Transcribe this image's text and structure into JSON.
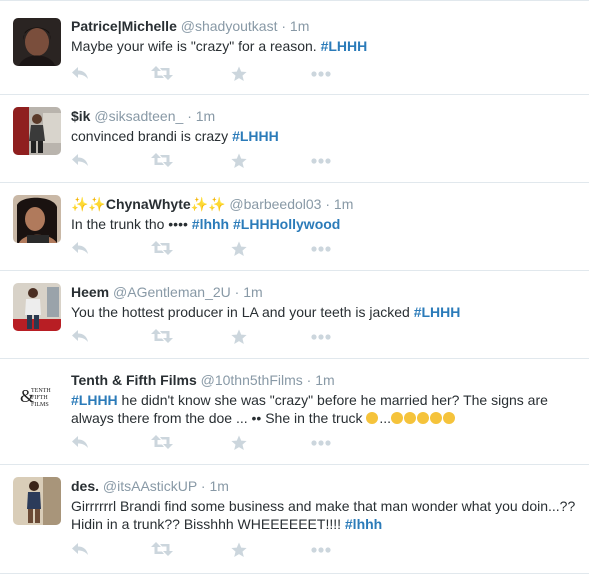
{
  "tweets": [
    {
      "name": "Patrice|Michelle",
      "handle": "@shadyoutkast",
      "sep": "·",
      "time": "1m",
      "segments": [
        {
          "t": "Maybe your wife is \"crazy\" for a reason. "
        },
        {
          "t": "#LHHH",
          "tag": true
        }
      ]
    },
    {
      "name": "$ik",
      "handle": "@siksadteen_",
      "sep": "·",
      "time": "1m",
      "segments": [
        {
          "t": "convinced brandi is crazy "
        },
        {
          "t": "#LHHH",
          "tag": true
        }
      ]
    },
    {
      "name": "✨✨ChynaWhyte✨✨",
      "handle": "@barbeedol03",
      "sep": "·",
      "time": "1m",
      "segments": [
        {
          "t": "In the trunk tho •••• "
        },
        {
          "t": "#lhhh",
          "tag": true
        },
        {
          "t": " "
        },
        {
          "t": "#LHHHollywood",
          "tag": true
        }
      ]
    },
    {
      "name": "Heem",
      "handle": "@AGentleman_2U",
      "sep": "·",
      "time": "1m",
      "segments": [
        {
          "t": "You the hottest producer in LA and your teeth is jacked "
        },
        {
          "t": "#LHHH",
          "tag": true
        }
      ]
    },
    {
      "name": "Tenth & Fifth Films",
      "handle": "@10thn5thFilms",
      "sep": "·",
      "time": "1m",
      "segments": [
        {
          "t": "#LHHH",
          "tag": true
        },
        {
          "t": " he didn't know she was \"crazy\" before he married her? The signs are always there from the doe ... •• She in the truck "
        },
        {
          "emoji": "smirk"
        },
        {
          "t": "..."
        },
        {
          "emoji": "weary"
        },
        {
          "emoji": "joy"
        },
        {
          "emoji": "joy"
        },
        {
          "emoji": "joy"
        },
        {
          "emoji": "grin"
        }
      ]
    },
    {
      "name": "des.",
      "handle": "@itsAAstickUP",
      "sep": "·",
      "time": "1m",
      "segments": [
        {
          "t": "Girrrrrrl Brandi find some business and make that man wonder what you doin...?? Hidin in a trunk?? Bisshhh WHEEEEEET!!!! "
        },
        {
          "t": "#lhhh",
          "tag": true
        }
      ]
    }
  ],
  "actions": [
    "reply-icon",
    "retweet-icon",
    "favorite-icon",
    "more-icon"
  ],
  "colors": {
    "name": "#292f33",
    "meta": "#8899a6",
    "hashtag": "#2b7bb9",
    "action_icon": "#ccd6dd",
    "divider": "#e1e8ed",
    "emoji": "#f5c33b"
  }
}
